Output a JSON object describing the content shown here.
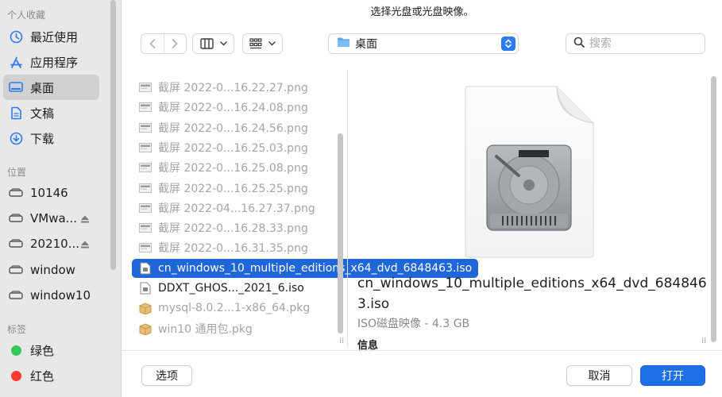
{
  "dialog": {
    "title": "选择光盘或光盘映像。"
  },
  "sidebar": {
    "favorites_header": "个人收藏",
    "favorites": [
      {
        "label": "最近使用",
        "icon": "clock-icon"
      },
      {
        "label": "应用程序",
        "icon": "apps-icon"
      },
      {
        "label": "桌面",
        "icon": "desktop-icon",
        "selected": true
      },
      {
        "label": "文稿",
        "icon": "document-icon"
      },
      {
        "label": "下载",
        "icon": "download-icon"
      }
    ],
    "locations_header": "位置",
    "locations": [
      {
        "label": "10146",
        "icon": "drive-icon",
        "eject": false
      },
      {
        "label": "VMwa...",
        "icon": "drive-icon",
        "eject": true
      },
      {
        "label": "20210...",
        "icon": "drive-icon",
        "eject": true
      },
      {
        "label": "window",
        "icon": "drive-icon",
        "eject": false
      },
      {
        "label": "window10",
        "icon": "drive-icon",
        "eject": false
      }
    ],
    "tags_header": "标签",
    "tags": [
      {
        "label": "绿色",
        "color": "#34c759"
      },
      {
        "label": "红色",
        "color": "#ff3b30"
      }
    ]
  },
  "toolbar": {
    "location": "桌面",
    "search_placeholder": "搜索"
  },
  "files": [
    {
      "name": "截屏 2022-0...16.22.27.png",
      "type": "png",
      "dim": true
    },
    {
      "name": "截屏 2022-0...16.24.08.png",
      "type": "png",
      "dim": true
    },
    {
      "name": "截屏 2022-0...16.24.56.png",
      "type": "png",
      "dim": true
    },
    {
      "name": "截屏 2022-0...16.25.03.png",
      "type": "png",
      "dim": true
    },
    {
      "name": "截屏 2022-0...16.25.08.png",
      "type": "png",
      "dim": true
    },
    {
      "name": "截屏 2022-0...16.25.25.png",
      "type": "png",
      "dim": true
    },
    {
      "name": "截屏 2022-04...16.27.37.png",
      "type": "png",
      "dim": true
    },
    {
      "name": "截屏 2022-0...16.28.33.png",
      "type": "png",
      "dim": true
    },
    {
      "name": "截屏 2022-0...16.31.35.png",
      "type": "png",
      "dim": true
    },
    {
      "name": "cn_windows_10_multiple_editions_x64_dvd_6848463.iso",
      "type": "iso",
      "dim": false,
      "selected": true
    },
    {
      "name": "DDXT_GHOS..._2021_6.iso",
      "type": "iso",
      "dim": false
    },
    {
      "name": "mysql-8.0.2...1-x86_64.pkg",
      "type": "pkg",
      "dim": true
    },
    {
      "name": "win10 通用包.pkg",
      "type": "pkg",
      "dim": true
    }
  ],
  "preview": {
    "name": "cn_windows_10_multiple_editions_x64_dvd_6848463.iso",
    "kind": "ISO磁盘映像 - 4.3 GB",
    "info_header": "信息"
  },
  "buttons": {
    "options": "选项",
    "cancel": "取消",
    "open": "打开"
  },
  "colors": {
    "accent": "#1f6fe6",
    "selection": "#1f66d9",
    "sidebar_bg": "#e8e8e8"
  }
}
